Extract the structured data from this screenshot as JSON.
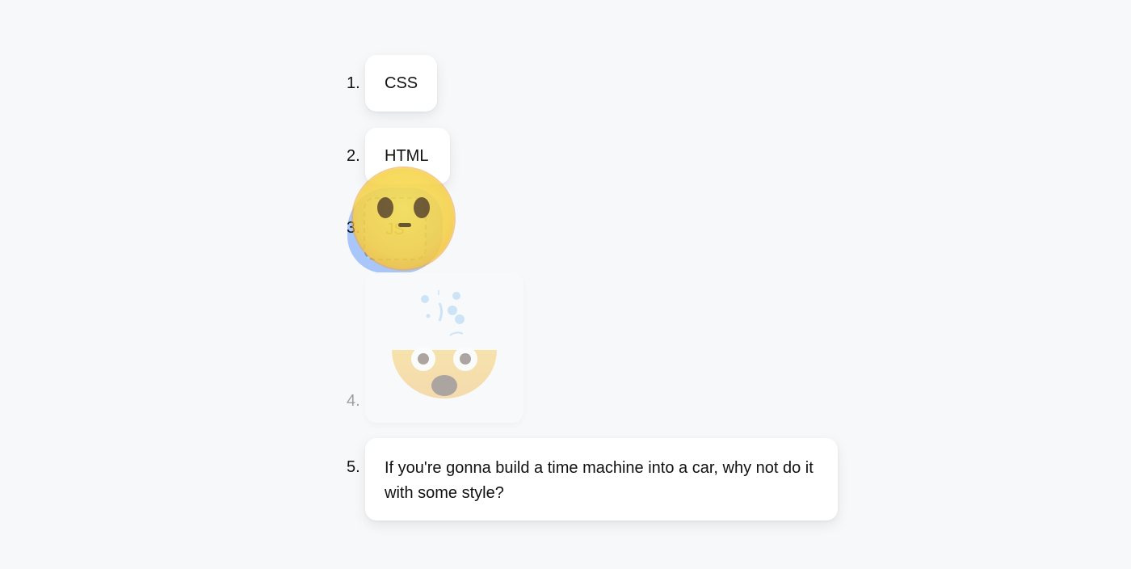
{
  "list": {
    "items": [
      {
        "number": "1.",
        "label": "CSS"
      },
      {
        "number": "2.",
        "label": "HTML"
      },
      {
        "number": "3.",
        "label": "JS"
      },
      {
        "number": "4.",
        "label": "",
        "icon": "exploding-head-emoji"
      },
      {
        "number": "5.",
        "label": "If you're gonna build a time machine into a car, why not do it with some style?"
      }
    ]
  },
  "drag": {
    "icon": "dragging-face-icon"
  },
  "colors": {
    "background": "#f7f8fa",
    "card": "#ffffff",
    "drag_highlight": "#a9c6fb",
    "emoji_yellow": "#f5d046"
  }
}
